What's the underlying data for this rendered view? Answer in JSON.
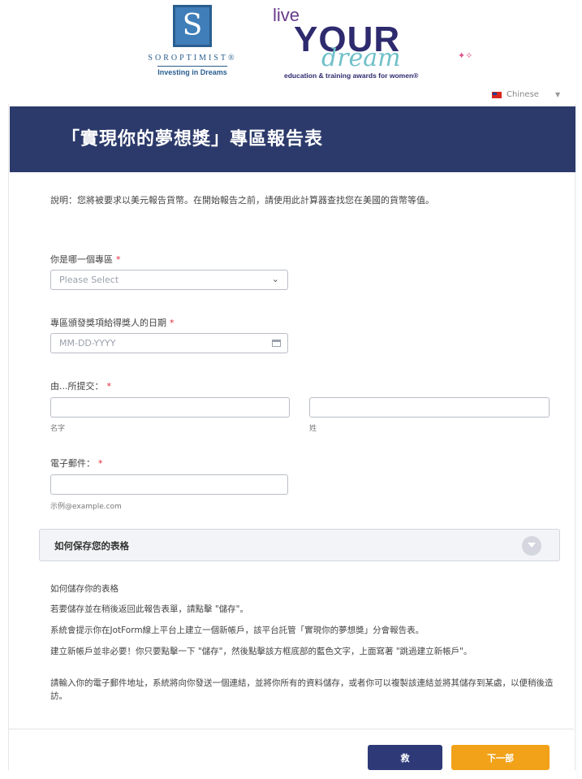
{
  "logos": {
    "soroptimist": {
      "symbol": "S",
      "name": "SOROPTIMIST®",
      "tagline": "Investing in Dreams"
    },
    "live_your_dream": {
      "live": "live",
      "your": "YOUR",
      "dream": "dream",
      "subtitle": "education & training awards for women®"
    }
  },
  "language": {
    "label": "Chinese"
  },
  "header": {
    "title": "「實現你的夢想獎」專區報告表",
    "background": "#2c3a6b"
  },
  "form": {
    "note": "說明：您將被要求以美元報告貨幣。在開始報告之前，請使用此計算器查找您在美國的貨幣等值。",
    "region": {
      "label": "你是哪一個專區",
      "placeholder": "Please Select"
    },
    "date": {
      "label": "專區頒發獎項給得獎人的日期",
      "placeholder": "MM-DD-YYYY"
    },
    "submitted_by": {
      "label": "由...所提交：",
      "first_sublabel": "名字",
      "last_sublabel": "姓"
    },
    "email": {
      "label": "電子郵件：",
      "sublabel": "示例@example.com"
    }
  },
  "save_section": {
    "title": "如何保存您的表格",
    "heading": "如何儲存你的表格",
    "lines": [
      "若要儲存並在稍後返回此報告表單，請點擊 \"儲存\"。",
      "系統會提示你在JotForm線上平台上建立一個新帳戶，該平台託管「實現你的夢想獎」分會報告表。",
      "建立新帳戶並非必要！你只要點擊一下 \"儲存\"，然後點擊該方框底部的藍色文字，上面寫著 \"跳過建立新帳戶\"。",
      "請輸入你的電子郵件地址，系統將向你發送一個連結，並將你所有的資料儲存，或者你可以複製該連結並將其儲存到某處，以便稍後造訪。"
    ]
  },
  "buttons": {
    "save": "救",
    "next": "下一部"
  },
  "colors": {
    "accent_save": "#2e3a78",
    "accent_next": "#f2a218",
    "required": "#e0293a"
  }
}
